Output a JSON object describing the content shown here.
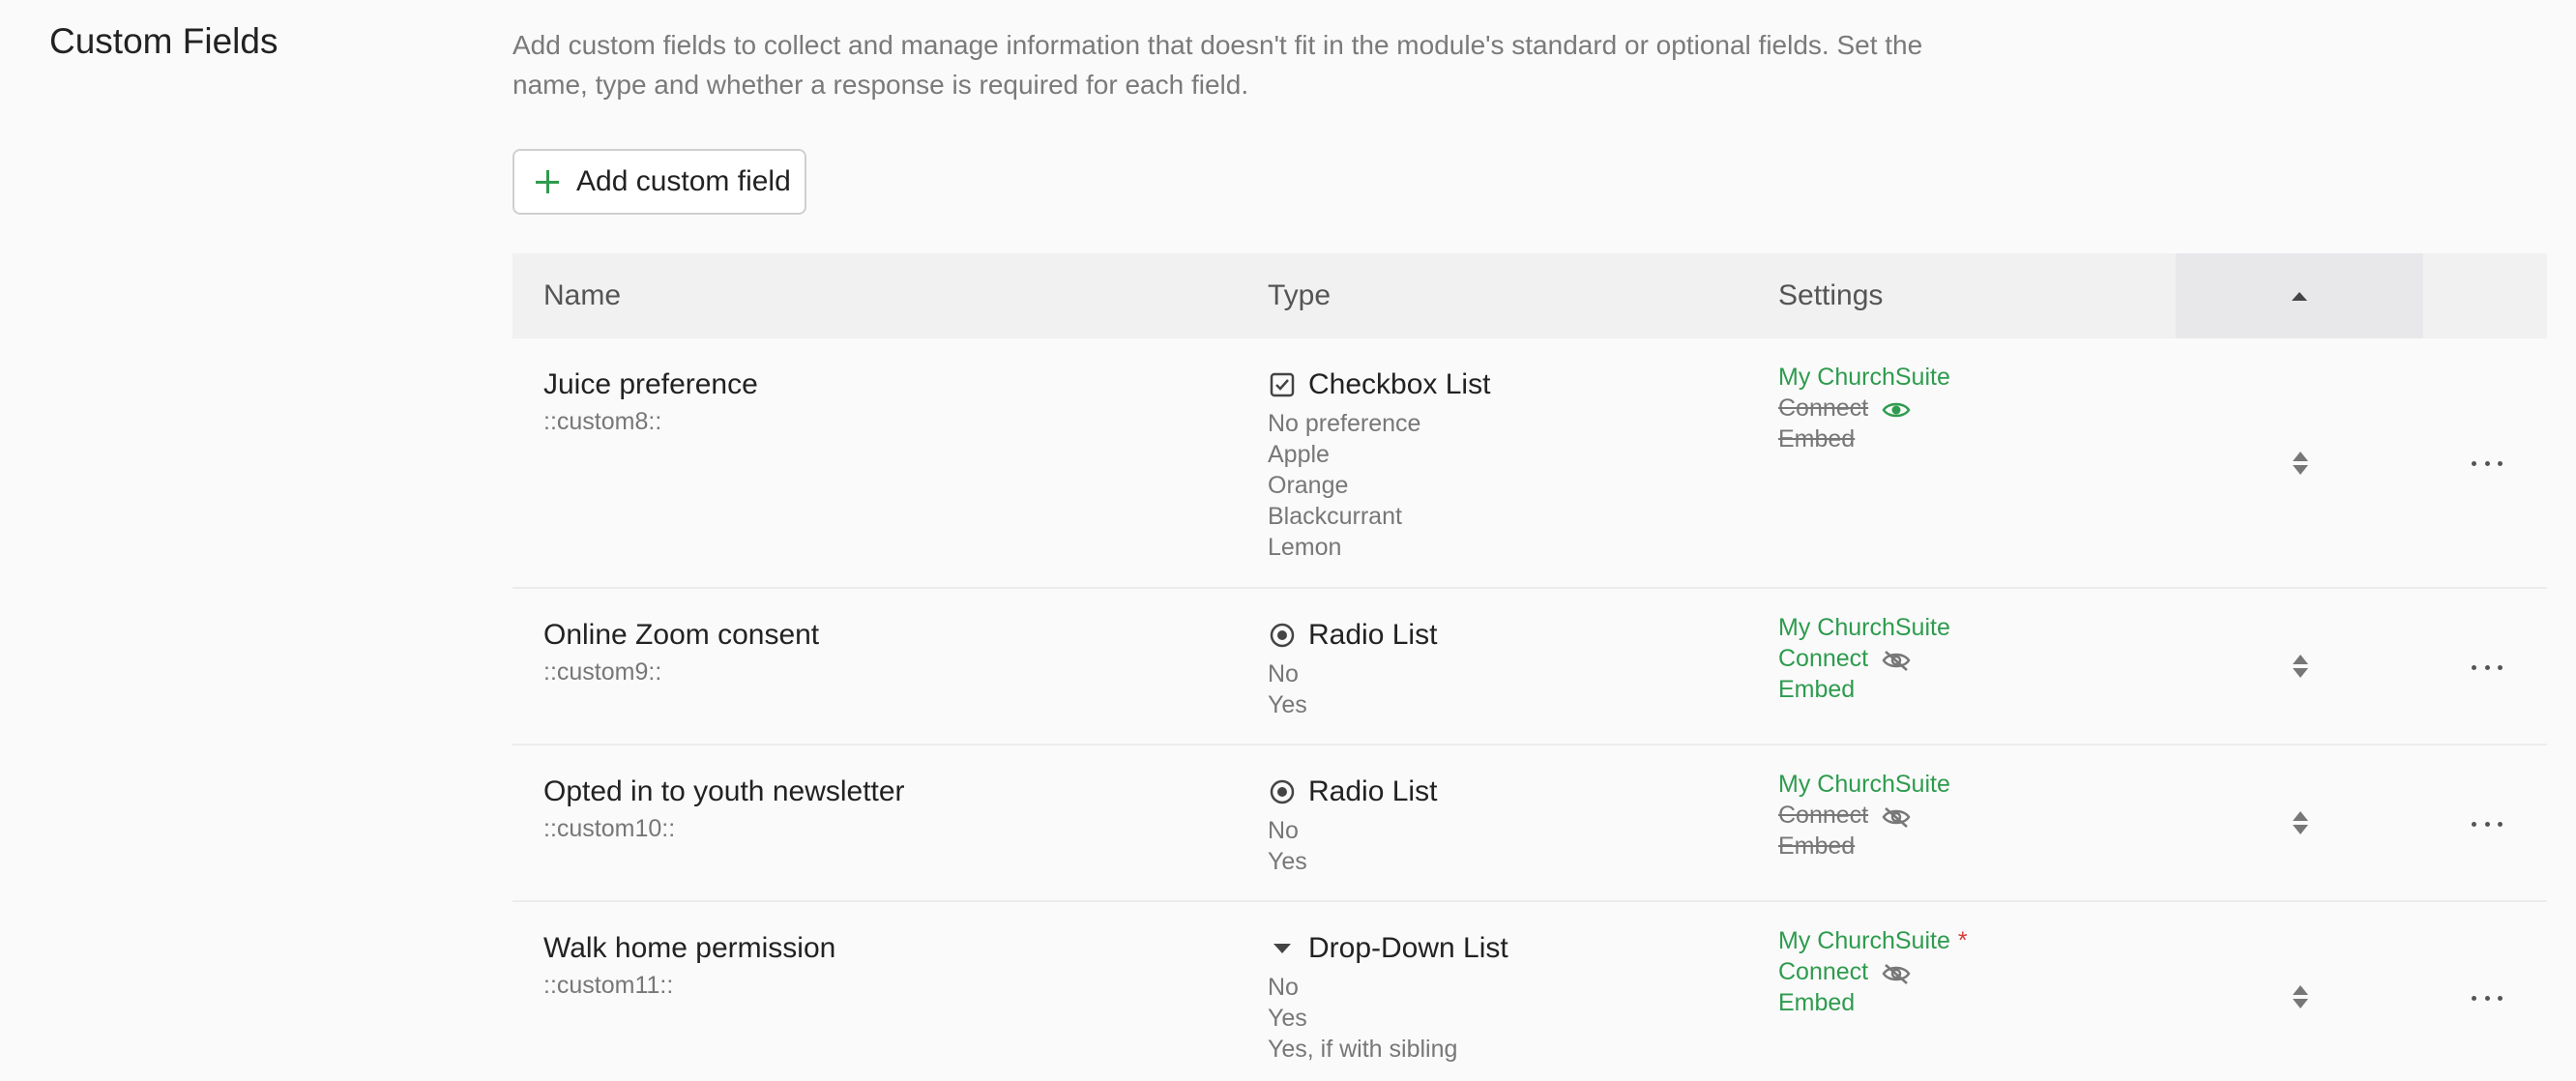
{
  "section": {
    "title": "Custom Fields",
    "description": "Add custom fields to collect and manage information that doesn't fit in the module's standard or optional fields. Set the name, type and whether a response is required for each field."
  },
  "add_button": {
    "label": "Add custom field",
    "icon": "plus-icon"
  },
  "table": {
    "headers": {
      "name": "Name",
      "type": "Type",
      "settings": "Settings",
      "sort_icon": "caret-up-icon"
    },
    "rows": [
      {
        "name": "Juice preference",
        "code": "::custom8::",
        "type": "Checkbox List",
        "type_icon": "checkbox-icon",
        "options": [
          "No preference",
          "Apple",
          "Orange",
          "Blackcurrant",
          "Lemon"
        ],
        "settings": [
          {
            "label": "My ChurchSuite",
            "enabled": true
          },
          {
            "label": "Connect",
            "enabled": false,
            "visibility_icon": "eye-icon"
          },
          {
            "label": "Embed",
            "enabled": false
          }
        ]
      },
      {
        "name": "Online Zoom consent",
        "code": "::custom9::",
        "type": "Radio List",
        "type_icon": "radio-icon",
        "options": [
          "No",
          "Yes"
        ],
        "settings": [
          {
            "label": "My ChurchSuite",
            "enabled": true
          },
          {
            "label": "Connect",
            "enabled": true,
            "visibility_icon": "eye-slash-icon"
          },
          {
            "label": "Embed",
            "enabled": true
          }
        ]
      },
      {
        "name": "Opted in to youth newsletter",
        "code": "::custom10::",
        "type": "Radio List",
        "type_icon": "radio-icon",
        "options": [
          "No",
          "Yes"
        ],
        "settings": [
          {
            "label": "My ChurchSuite",
            "enabled": true
          },
          {
            "label": "Connect",
            "enabled": false,
            "visibility_icon": "eye-slash-icon"
          },
          {
            "label": "Embed",
            "enabled": false
          }
        ]
      },
      {
        "name": "Walk home permission",
        "code": "::custom11::",
        "type": "Drop-Down List",
        "type_icon": "dropdown-caret-icon",
        "options": [
          "No",
          "Yes",
          "Yes, if with sibling"
        ],
        "settings": [
          {
            "label": "My ChurchSuite",
            "enabled": true,
            "required_mark": "*"
          },
          {
            "label": "Connect",
            "enabled": true,
            "visibility_icon": "eye-slash-icon"
          },
          {
            "label": "Embed",
            "enabled": true
          }
        ]
      }
    ]
  },
  "colors": {
    "accent": "#2e9b4e",
    "required": "#d63b3b",
    "muted": "#777777"
  }
}
